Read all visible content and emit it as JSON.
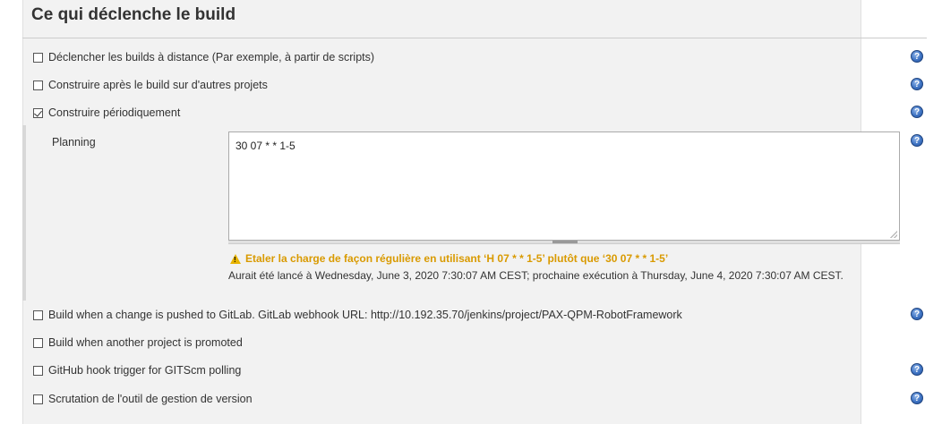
{
  "section": {
    "title": "Ce qui déclenche le build"
  },
  "triggers": [
    {
      "label": "Déclencher les builds à distance (Par exemple, à partir de scripts)",
      "checked": false,
      "help": true
    },
    {
      "label": "Construire après le build sur d'autres projets",
      "checked": false,
      "help": true
    },
    {
      "label": "Construire périodiquement",
      "checked": true,
      "help": true
    }
  ],
  "planning": {
    "label": "Planning",
    "value": "30 07 * * 1-5",
    "warning": "Etaler la charge de façon régulière en utilisant ‘H 07 * * 1-5’ plutôt que ‘30 07 * * 1-5’",
    "info": "Aurait été lancé à Wednesday, June 3, 2020 7:30:07 AM CEST; prochaine exécution à Thursday, June 4, 2020 7:30:07 AM CEST."
  },
  "more_triggers": [
    {
      "label": "Build when a change is pushed to GitLab. GitLab webhook URL: http://10.192.35.70/jenkins/project/PAX-QPM-RobotFramework",
      "checked": false,
      "help": true
    },
    {
      "label": "Build when another project is promoted",
      "checked": false,
      "help": false
    },
    {
      "label": "GitHub hook trigger for GITScm polling",
      "checked": false,
      "help": true
    },
    {
      "label": "Scrutation de l'outil de gestion de version",
      "checked": false,
      "help": true
    }
  ],
  "icons": {
    "help": "help-icon",
    "warning": "warning-icon",
    "checkbox": "checkbox"
  },
  "colors": {
    "warning": "#d99a00",
    "help": "#3f74c4",
    "panel": "#f2f2f2"
  }
}
